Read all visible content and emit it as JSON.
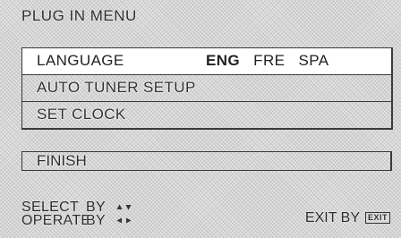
{
  "title": "PLUG IN MENU",
  "menu": {
    "items": [
      {
        "label": "LANGUAGE"
      },
      {
        "label": "AUTO TUNER SETUP"
      },
      {
        "label": "SET CLOCK"
      }
    ],
    "language_options": [
      "ENG",
      "FRE",
      "SPA"
    ],
    "language_selected": "ENG"
  },
  "finish_label": "FINISH",
  "help": {
    "select_label": "SELECT",
    "operate_label": "OPERATE",
    "by_label": "BY",
    "select_icon": "up-down-arrows-icon",
    "operate_icon": "left-right-arrows-icon"
  },
  "exit": {
    "label": "EXIT BY",
    "key_label": "EXIT"
  }
}
